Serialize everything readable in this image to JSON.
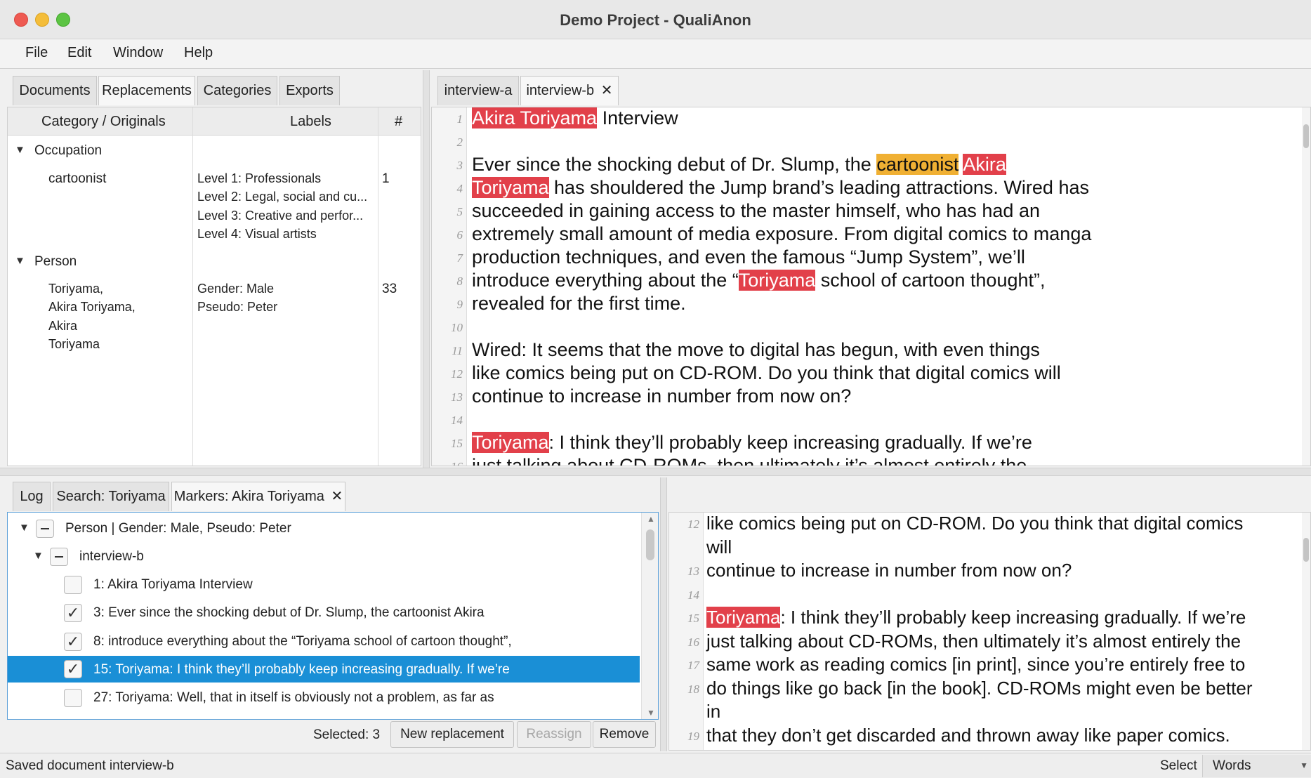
{
  "window": {
    "title": "Demo Project - QualiAnon"
  },
  "menu": [
    "File",
    "Edit",
    "Window",
    "Help"
  ],
  "left_tabs": [
    "Documents",
    "Replacements",
    "Categories",
    "Exports"
  ],
  "replacements_table": {
    "headers": [
      "Category / Originals",
      "Labels",
      "#"
    ],
    "groups": [
      {
        "name": "Occupation",
        "rows": [
          {
            "originals": [
              "cartoonist"
            ],
            "labels": [
              "Level 1: Professionals",
              "Level 2: Legal, social and cu...",
              "Level 3: Creative and perfor...",
              "Level 4: Visual artists"
            ],
            "count": "1"
          }
        ]
      },
      {
        "name": "Person",
        "rows": [
          {
            "originals": [
              "Toriyama,",
              "Akira Toriyama,",
              "Akira",
              "Toriyama"
            ],
            "labels": [
              "Gender: Male",
              "Pseudo: Peter"
            ],
            "count": "33"
          }
        ]
      }
    ]
  },
  "editor_tabs": [
    {
      "label": "interview-a"
    },
    {
      "label": "interview-b",
      "close": "✕"
    }
  ],
  "editor": {
    "lines": [
      {
        "n": "1",
        "segs": [
          {
            "t": "Akira Toriyama",
            "m": "red"
          },
          {
            "t": " Interview"
          }
        ]
      },
      {
        "n": "2",
        "segs": []
      },
      {
        "n": "3",
        "segs": [
          {
            "t": "Ever since the shocking debut of Dr. Slump, the "
          },
          {
            "t": "cartoonist",
            "m": "orange"
          },
          {
            "t": " "
          },
          {
            "t": "Akira",
            "m": "red"
          }
        ]
      },
      {
        "n": "4",
        "segs": [
          {
            "t": "Toriyama",
            "m": "red"
          },
          {
            "t": " has shouldered the Jump brand’s leading attractions. Wired has"
          }
        ]
      },
      {
        "n": "5",
        "segs": [
          {
            "t": "succeeded in gaining access to the master himself, who has had an"
          }
        ]
      },
      {
        "n": "6",
        "segs": [
          {
            "t": "extremely small amount of media exposure. From digital comics to manga"
          }
        ]
      },
      {
        "n": "7",
        "segs": [
          {
            "t": "production techniques, and even the famous “Jump System”, we’ll"
          }
        ]
      },
      {
        "n": "8",
        "segs": [
          {
            "t": "introduce everything about the “"
          },
          {
            "t": "Toriyama",
            "m": "red"
          },
          {
            "t": " school of cartoon thought”,"
          }
        ]
      },
      {
        "n": "9",
        "segs": [
          {
            "t": "revealed for the first time."
          }
        ]
      },
      {
        "n": "10",
        "segs": []
      },
      {
        "n": "11",
        "segs": [
          {
            "t": "Wired: It seems that the move to digital has begun, with even things"
          }
        ]
      },
      {
        "n": "12",
        "segs": [
          {
            "t": "like comics being put on CD-ROM. Do you think that digital comics will"
          }
        ]
      },
      {
        "n": "13",
        "segs": [
          {
            "t": "continue to increase in number from now on?"
          }
        ]
      },
      {
        "n": "14",
        "segs": []
      },
      {
        "n": "15",
        "segs": [
          {
            "t": "Toriyama",
            "m": "red"
          },
          {
            "t": ": I think they’ll probably keep increasing gradually. If we’re"
          }
        ]
      },
      {
        "n": "16",
        "segs": [
          {
            "t": "just talking about CD-ROMs, then ultimately it’s almost entirely the"
          }
        ]
      }
    ]
  },
  "bottom_tabs": [
    {
      "label": "Log"
    },
    {
      "label": "Search: Toriyama"
    },
    {
      "label": "Markers: Akira Toriyama",
      "close": "✕"
    }
  ],
  "markers_tree": {
    "root": "Person | Gender: Male, Pseudo: Peter",
    "doc": "interview-b",
    "items": [
      {
        "text": "1: Akira Toriyama Interview",
        "checked": false,
        "check_glyph": ""
      },
      {
        "text": "3: Ever since the shocking debut of Dr. Slump, the cartoonist Akira",
        "checked": true,
        "check_glyph": "✓"
      },
      {
        "text": "8: introduce everything about the “Toriyama school of cartoon thought”,",
        "checked": true,
        "check_glyph": "✓"
      },
      {
        "text": "15: Toriyama: I think they’ll probably keep increasing gradually. If we’re",
        "checked": true,
        "check_glyph": "✓",
        "selected": true
      },
      {
        "text": "27: Toriyama: Well, that in itself is obviously not a problem, as far as",
        "checked": false,
        "check_glyph": ""
      }
    ]
  },
  "markers_footer": {
    "selected": "Selected: 3",
    "new": "New replacement",
    "reassign": "Reassign",
    "remove": "Remove"
  },
  "preview": {
    "lines": [
      {
        "n": "12",
        "segs": [
          {
            "t": "like comics being put on CD-ROM. Do you think that digital comics"
          }
        ]
      },
      {
        "n": "",
        "segs": [
          {
            "t": "will"
          }
        ]
      },
      {
        "n": "13",
        "segs": [
          {
            "t": "continue to increase in number from now on?"
          }
        ]
      },
      {
        "n": "14",
        "segs": []
      },
      {
        "n": "15",
        "segs": [
          {
            "t": "Toriyama",
            "m": "red"
          },
          {
            "t": ": I think they’ll probably keep increasing gradually. If we’re"
          }
        ]
      },
      {
        "n": "16",
        "segs": [
          {
            "t": "just talking about CD-ROMs, then ultimately it’s almost entirely the"
          }
        ]
      },
      {
        "n": "17",
        "segs": [
          {
            "t": "same work as reading comics [in print], since you’re entirely free to"
          }
        ]
      },
      {
        "n": "18",
        "segs": [
          {
            "t": "do things like go back [in the book]. CD-ROMs might even be better"
          }
        ]
      },
      {
        "n": "",
        "segs": [
          {
            "t": "in"
          }
        ]
      },
      {
        "n": "19",
        "segs": [
          {
            "t": "that they don’t get discarded and thrown away like paper comics."
          }
        ]
      }
    ]
  },
  "status": {
    "message": "Saved document interview-b",
    "select_label": "Select",
    "select_value": "Words"
  },
  "colors": {
    "marker_red": "#e2404a",
    "marker_orange": "#f0b033",
    "selection_blue": "#1a8fd6"
  }
}
